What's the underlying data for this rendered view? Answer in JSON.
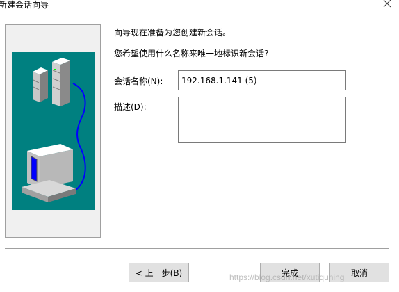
{
  "window": {
    "title": "新建会话向导"
  },
  "intro": {
    "line1": "向导现在准备为您创建新会话。",
    "line2": "您希望使用什么名称来唯一地标识新会话?"
  },
  "form": {
    "session_name_label": "会话名称(N):",
    "session_name_value": "192.168.1.141 (5)",
    "description_label": "描述(D):",
    "description_value": ""
  },
  "buttons": {
    "back": "< 上一步(B)",
    "finish": "完成",
    "cancel": "取消"
  },
  "watermark": "https://blog.csdn.net/xutiquning",
  "icons": {
    "close": "close-icon",
    "illustration": "network-servers-computer-illustration"
  },
  "colors": {
    "illustration_bg": "#008080",
    "cable": "#0000ff",
    "monitor_screen": "#0000ff"
  }
}
